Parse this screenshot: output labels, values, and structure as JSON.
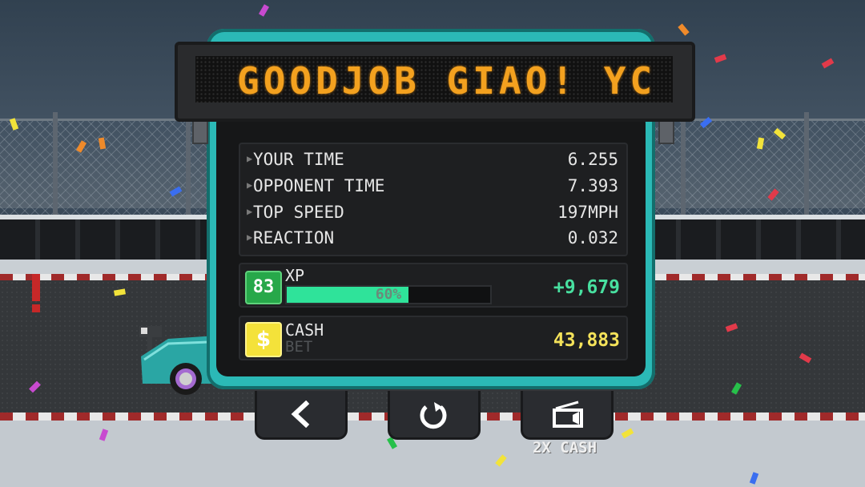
{
  "banner": {
    "text": "GOODJOB GIAO! YC"
  },
  "stats": [
    {
      "label": "YOUR TIME",
      "value": "6.255"
    },
    {
      "label": "OPPONENT TIME",
      "value": "7.393"
    },
    {
      "label": "TOP SPEED",
      "value": "197MPH"
    },
    {
      "label": "REACTION",
      "value": "0.032"
    }
  ],
  "xp": {
    "level": "83",
    "label": "XP",
    "progress_text": "60%",
    "progress_fraction": 0.6,
    "gain": "+9,679"
  },
  "cash": {
    "icon": "$",
    "label": "CASH",
    "sub_label": "BET",
    "value": "43,883"
  },
  "buttons": {
    "back": {
      "icon": "chevron-left-icon"
    },
    "restart": {
      "icon": "refresh-icon"
    },
    "double_cash": {
      "icon": "tv-ad-icon",
      "caption": "2X CASH"
    }
  },
  "colors": {
    "panel_frame": "#2bb9b6",
    "banner_text": "#f3a11f",
    "xp_level_badge": "#27a84a",
    "xp_bar": "#2fe39a",
    "xp_gain": "#48e0a0",
    "cash_icon": "#f4e23a",
    "cash_value": "#f4e25a"
  }
}
